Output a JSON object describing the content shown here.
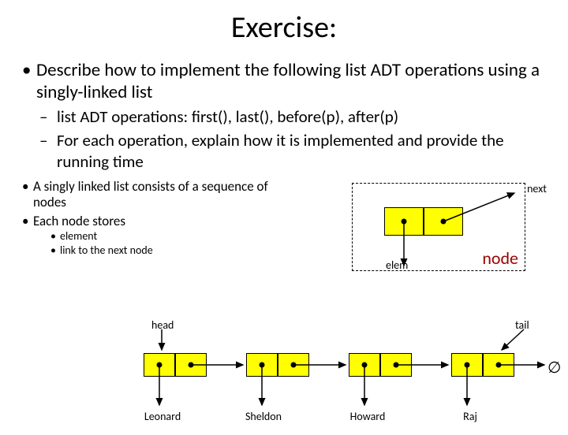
{
  "title": "Exercise:",
  "b1": "Describe how to implement the following list ADT operations using a singly-linked list",
  "b2a": "list ADT operations: first(), last(), before(p), after(p)",
  "b2b": "For each operation, explain how it is implemented and provide the running time",
  "b3a": "A singly linked list consists of a sequence of nodes",
  "b3b": "Each node stores",
  "b4a": "element",
  "b4b": "link to the next node",
  "lbl_next": "next",
  "lbl_elem": "elem",
  "lbl_node": "node",
  "lbl_head": "head",
  "lbl_tail": "tail",
  "lbl_empty": "∅",
  "names": [
    "Leonard",
    "Sheldon",
    "Howard",
    "Raj"
  ]
}
